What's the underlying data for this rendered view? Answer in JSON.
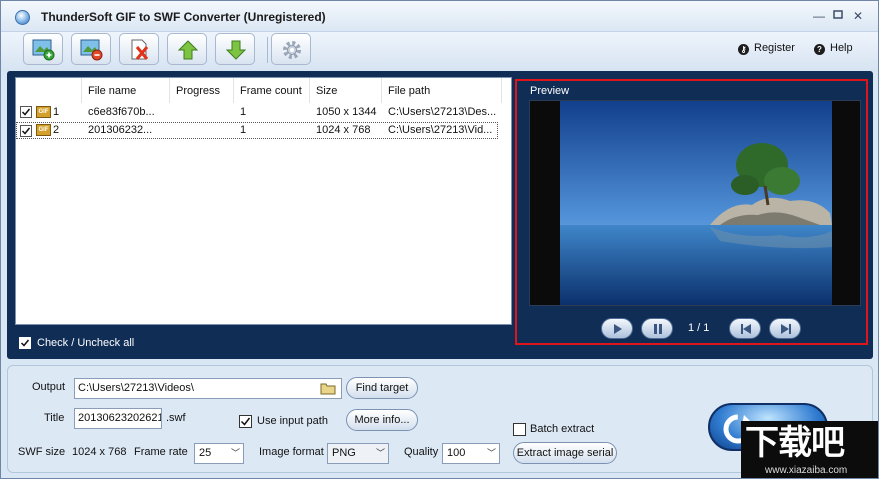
{
  "window": {
    "title": "ThunderSoft GIF to SWF Converter (Unregistered)"
  },
  "toolbar": {
    "buttons": [
      {
        "icon": "add-image-icon"
      },
      {
        "icon": "remove-image-icon"
      },
      {
        "icon": "clear-list-icon"
      },
      {
        "icon": "move-up-icon"
      },
      {
        "icon": "move-down-icon"
      },
      {
        "icon": "gear-icon"
      }
    ],
    "register_label": "Register",
    "help_label": "Help"
  },
  "file_list": {
    "columns": [
      "File name",
      "Progress",
      "Frame count",
      "Size",
      "File path"
    ],
    "rows": [
      {
        "index": "1",
        "checked": true,
        "file_name": "c6e83f670b...",
        "progress": "",
        "frame_count": "1",
        "size": "1050 x 1344",
        "file_path": "C:\\Users\\27213\\Des..."
      },
      {
        "index": "2",
        "checked": true,
        "file_name": "201306232...",
        "progress": "",
        "frame_count": "1",
        "size": "1024 x 768",
        "file_path": "C:\\Users\\27213\\Vid..."
      }
    ],
    "check_all_label": "Check / Uncheck all"
  },
  "preview": {
    "label": "Preview",
    "pager": "1 / 1"
  },
  "output": {
    "output_label": "Output",
    "output_path": "C:\\Users\\27213\\Videos\\",
    "find_target_label": "Find target",
    "title_label": "Title",
    "title_value": "20130623202621",
    "title_ext": ".swf",
    "use_input_path_label": "Use input path",
    "more_info_label": "More info...",
    "batch_extract_label": "Batch extract",
    "swf_size_label": "SWF size",
    "swf_size_value": "1024 x 768",
    "frame_rate_label": "Frame rate",
    "frame_rate_value": "25",
    "image_format_label": "Image format",
    "image_format_value": "PNG",
    "quality_label": "Quality",
    "quality_value": "100",
    "extract_serial_label": "Extract image serial"
  },
  "watermark": {
    "big": "下载吧",
    "small": "www.xiazaiba.com"
  }
}
